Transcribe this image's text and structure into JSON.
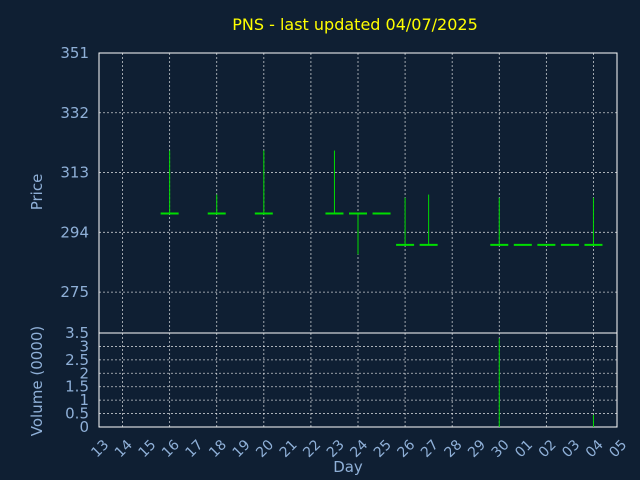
{
  "chart_data": {
    "type": "bar",
    "title": "PNS - last updated 04/07/2025",
    "xlabel": "Day",
    "price_ylabel": "Price",
    "volume_ylabel": "Volume (0000)",
    "x_ticks": [
      "13",
      "14",
      "15",
      "16",
      "17",
      "18",
      "19",
      "20",
      "21",
      "22",
      "23",
      "24",
      "25",
      "26",
      "27",
      "28",
      "29",
      "30",
      "01",
      "02",
      "03",
      "04",
      "05"
    ],
    "price_ylim": [
      262,
      351
    ],
    "price_ticks": [
      351,
      332,
      313,
      294,
      275
    ],
    "volume_ylim": [
      0,
      3.5
    ],
    "volume_ticks": [
      3.5,
      3,
      2.5,
      2,
      1.5,
      1,
      0.5,
      0
    ],
    "grid": true,
    "colors": {
      "background": "#0f1f33",
      "title": "#ffff00",
      "axis_text": "#8fb0d8",
      "bars": "#00dd00",
      "grid": "#ffffff"
    },
    "price_bars": [
      {
        "day": "16",
        "high": 320,
        "low": 300,
        "close": 300
      },
      {
        "day": "18",
        "high": 306,
        "low": 300,
        "close": 300
      },
      {
        "day": "20",
        "high": 320,
        "low": 300,
        "close": 300
      },
      {
        "day": "23",
        "high": 320,
        "low": 300,
        "close": 300
      },
      {
        "day": "24",
        "high": 300,
        "low": 287,
        "close": 300
      },
      {
        "day": "25",
        "high": 300,
        "low": 300,
        "close": 300
      },
      {
        "day": "26",
        "high": 305,
        "low": 290,
        "close": 290
      },
      {
        "day": "27",
        "high": 306,
        "low": 290,
        "close": 290
      },
      {
        "day": "30",
        "high": 305,
        "low": 290,
        "close": 290
      },
      {
        "day": "01",
        "high": 290,
        "low": 290,
        "close": 290
      },
      {
        "day": "02",
        "high": 290,
        "low": 290,
        "close": 290
      },
      {
        "day": "03",
        "high": 290,
        "low": 290,
        "close": 290
      },
      {
        "day": "04",
        "high": 305,
        "low": 290,
        "close": 290
      }
    ],
    "volume_bars": [
      {
        "day": "30",
        "value": 3.3
      },
      {
        "day": "04",
        "value": 0.45
      }
    ]
  }
}
